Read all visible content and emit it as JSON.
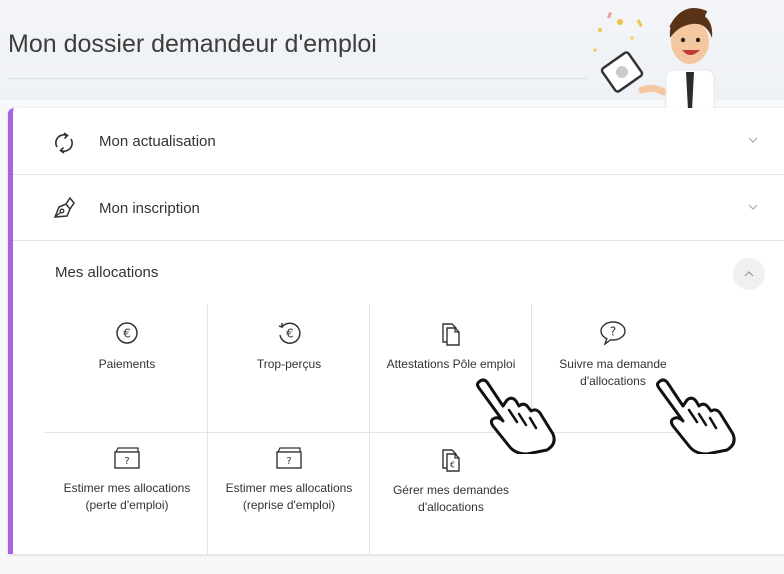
{
  "header": {
    "title": "Mon dossier demandeur d'emploi"
  },
  "accordion": {
    "items": [
      {
        "label": "Mon actualisation",
        "icon": "refresh-icon",
        "state": "collapsed"
      },
      {
        "label": "Mon inscription",
        "icon": "pen-icon",
        "state": "collapsed"
      }
    ],
    "allocations": {
      "title": "Mes allocations",
      "state": "expanded",
      "tiles": [
        {
          "label": "Paiements",
          "icon": "euro-circle-icon"
        },
        {
          "label": "Trop-perçus",
          "icon": "euro-refund-icon"
        },
        {
          "label": "Attestations Pôle emploi",
          "icon": "documents-icon"
        },
        {
          "label": "Suivre ma demande d'allocations",
          "icon": "question-bubble-icon"
        },
        {
          "label": "Estimer mes allocations (perte d'emploi)",
          "icon": "estimate-card-icon"
        },
        {
          "label": "Estimer mes allocations (reprise d'emploi)",
          "icon": "estimate-card-icon"
        },
        {
          "label": "Gérer mes demandes d'allocations",
          "icon": "euro-documents-icon"
        }
      ]
    }
  },
  "colors": {
    "accent": "#a860e6",
    "border": "#e3e3e3",
    "text": "#333333"
  }
}
